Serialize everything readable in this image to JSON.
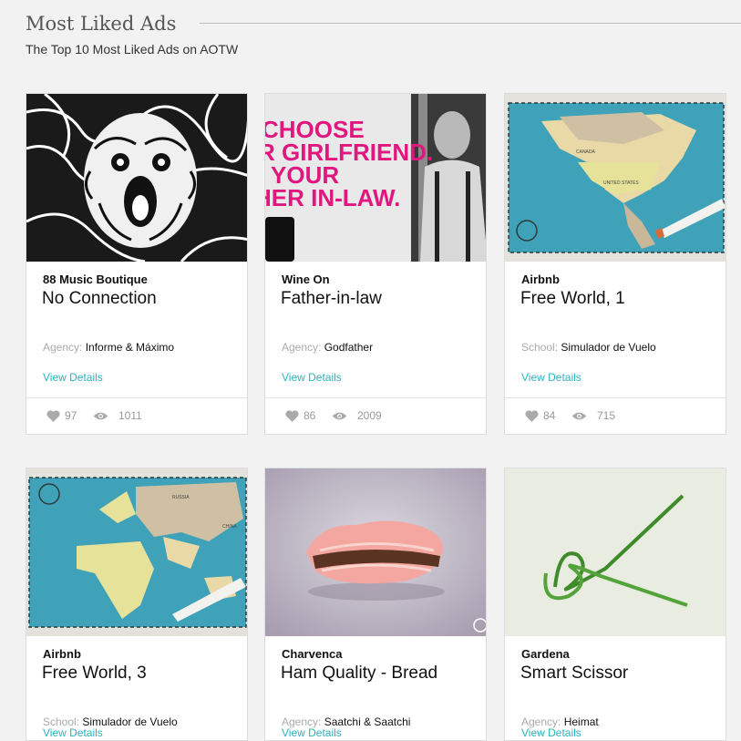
{
  "header": {
    "title": "Most Liked Ads",
    "subtitle": "The Top 10 Most Liked Ads on AOTW"
  },
  "labels": {
    "agency": "Agency:",
    "school": "School:",
    "view_details": "View Details"
  },
  "cards": [
    {
      "brand": "88 Music Boutique",
      "title": "No Connection",
      "credit_label": "Agency:",
      "credit": "Informe & Máximo",
      "likes": "97",
      "views": "1011"
    },
    {
      "brand": "Wine On",
      "title": "Father-in-law",
      "credit_label": "Agency:",
      "credit": "Godfather",
      "likes": "86",
      "views": "2009",
      "image_text": [
        "CHOOSE",
        "R GIRLFRIEND.",
        "YOUR",
        "HER IN-LAW."
      ]
    },
    {
      "brand": "Airbnb",
      "title": "Free World, 1",
      "credit_label": "School:",
      "credit": "Simulador de Vuelo",
      "likes": "84",
      "views": "715",
      "image_text": [
        "CANADA",
        "UNITED STATES"
      ]
    },
    {
      "brand": "Airbnb",
      "title": "Free World, 3",
      "credit_label": "School:",
      "credit": "Simulador de Vuelo",
      "image_text": [
        "RUSSIA",
        "CHINA"
      ]
    },
    {
      "brand": "Charvenca",
      "title": "Ham Quality - Bread",
      "credit_label": "Agency:",
      "credit": "Saatchi & Saatchi"
    },
    {
      "brand": "Gardena",
      "title": "Smart Scissor",
      "credit_label": "Agency:",
      "credit": "Heimat"
    }
  ],
  "colors": {
    "accent": "#2bb3c0",
    "background": "#f2f2f2",
    "map_ocean": "#3fa2b8",
    "wine_magenta": "#e0177e"
  },
  "icons": [
    "heart-icon",
    "eye-icon"
  ]
}
